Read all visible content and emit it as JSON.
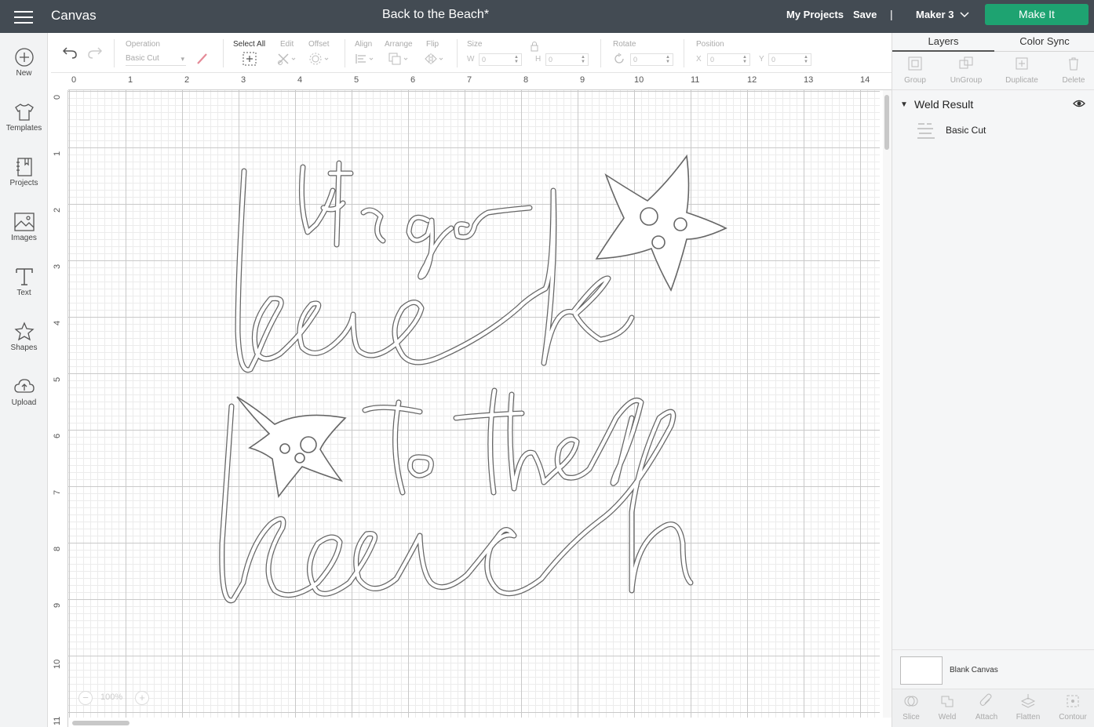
{
  "header": {
    "app_name": "Canvas",
    "doc_title": "Back to the Beach*",
    "my_projects": "My Projects",
    "save": "Save",
    "separator": "|",
    "machine": "Maker 3",
    "make_it": "Make It"
  },
  "sidebar": {
    "items": [
      {
        "label": "New",
        "icon": "plus-circle-icon"
      },
      {
        "label": "Templates",
        "icon": "tshirt-icon"
      },
      {
        "label": "Projects",
        "icon": "notebook-icon"
      },
      {
        "label": "Images",
        "icon": "image-icon"
      },
      {
        "label": "Text",
        "icon": "text-icon"
      },
      {
        "label": "Shapes",
        "icon": "shapes-icon"
      },
      {
        "label": "Upload",
        "icon": "cloud-upload-icon"
      }
    ]
  },
  "toolbar": {
    "operation_label": "Operation",
    "operation_value": "Basic Cut",
    "select_all": "Select All",
    "edit": "Edit",
    "offset": "Offset",
    "align": "Align",
    "arrange": "Arrange",
    "flip": "Flip",
    "size": "Size",
    "w_label": "W",
    "w_value": "0",
    "h_label": "H",
    "h_value": "0",
    "rotate": "Rotate",
    "rotate_value": "0",
    "position": "Position",
    "x_label": "X",
    "x_value": "0",
    "y_label": "Y",
    "y_value": "0"
  },
  "canvas": {
    "ruler_top": [
      "0",
      "1",
      "2",
      "3",
      "4",
      "5",
      "6",
      "7",
      "8",
      "9",
      "10",
      "11",
      "12",
      "13",
      "14"
    ],
    "ruler_left": [
      "0",
      "1",
      "2",
      "3",
      "4",
      "5",
      "6",
      "7",
      "8",
      "9",
      "10",
      "11"
    ],
    "zoom_minus": "−",
    "zoom_value": "100%",
    "zoom_plus": "+",
    "design_lines": [
      "let's go",
      "back",
      "to the",
      "beach"
    ]
  },
  "right_panel": {
    "tabs": [
      "Layers",
      "Color Sync"
    ],
    "actions": [
      "Group",
      "UnGroup",
      "Duplicate",
      "Delete"
    ],
    "group_name": "Weld Result",
    "layer_name": "Basic Cut",
    "blank_canvas": "Blank Canvas",
    "bottom_actions": [
      "Slice",
      "Weld",
      "Attach",
      "Flatten",
      "Contour"
    ]
  },
  "colors": {
    "header_bg": "#434b53",
    "make_it_green": "#1ea371",
    "sidebar_bg": "#f2f3f4",
    "panel_bg": "#f5f6f7",
    "grid_major": "#c9c9c9",
    "grid_minor": "#ececec"
  }
}
